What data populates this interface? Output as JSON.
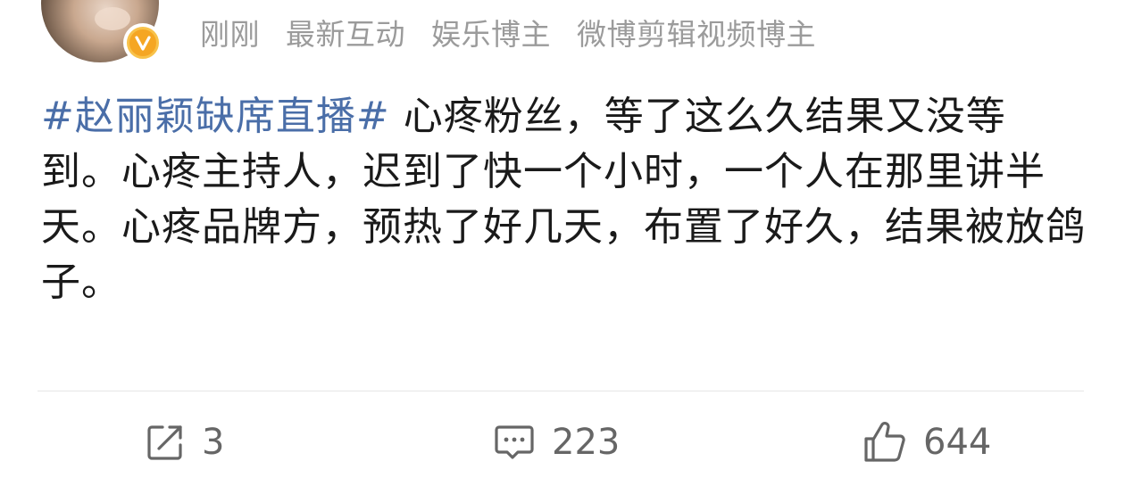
{
  "header": {
    "time": "刚刚",
    "source": "最新互动",
    "tag1": "娱乐博主",
    "tag2": "微博剪辑视频博主",
    "badge_letter": "V"
  },
  "post": {
    "hashtag": "#赵丽颖缺席直播#",
    "body": " 心疼粉丝，等了这么久结果又没等到。心疼主持人，迟到了快一个小时，一个人在那里讲半天。心疼品牌方，预热了好几天，布置了好久，结果被放鸽子。"
  },
  "actions": {
    "reposts": "3",
    "comments": "223",
    "likes": "644"
  },
  "icons": {
    "repost": "repost-icon",
    "comment": "comment-icon",
    "like": "like-icon",
    "verified": "verified-badge-icon"
  },
  "colors": {
    "hashtag": "#4a6ea8",
    "meta": "#9b9b9b",
    "badge": "#f5a623"
  }
}
